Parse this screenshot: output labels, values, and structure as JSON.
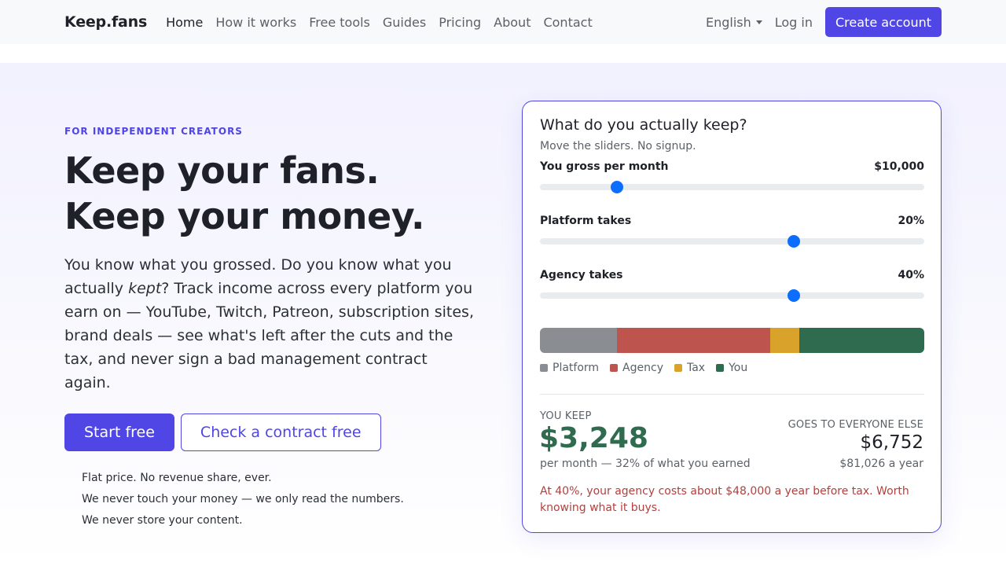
{
  "nav": {
    "brand": "Keep.fans",
    "links": [
      {
        "label": "Home",
        "active": true
      },
      {
        "label": "How it works"
      },
      {
        "label": "Free tools"
      },
      {
        "label": "Guides"
      },
      {
        "label": "Pricing"
      },
      {
        "label": "About"
      },
      {
        "label": "Contact"
      }
    ],
    "language": "English",
    "login": "Log in",
    "create_account": "Create account"
  },
  "hero": {
    "eyebrow": "FOR INDEPENDENT CREATORS",
    "headline_line1": "Keep your fans.",
    "headline_line2": "Keep your money.",
    "lead_part1": "You know what you grossed. Do you know what you actually ",
    "lead_emph": "kept",
    "lead_part2": "? Track income across every platform you earn on — YouTube, Twitch, Patreon, subscription sites, brand deals — see what's left after the cuts and the tax, and never sign a bad management contract again.",
    "cta_primary": "Start free",
    "cta_secondary": "Check a contract free",
    "assurances": [
      "Flat price. No revenue share, ever.",
      "We never touch your money — we only read the numbers.",
      "We never store your content."
    ]
  },
  "calculator": {
    "title": "What do you actually keep?",
    "subtitle": "Move the sliders. No signup.",
    "sliders": [
      {
        "label": "You gross per month",
        "value": "$10,000",
        "fraction": 0.2
      },
      {
        "label": "Platform takes",
        "value": "20%",
        "fraction": 0.66
      },
      {
        "label": "Agency takes",
        "value": "40%",
        "fraction": 0.66
      }
    ],
    "breakdown": [
      {
        "label": "Platform",
        "share": 0.2,
        "color": "#8a8d91"
      },
      {
        "label": "Agency",
        "share": 0.4,
        "color": "#bd554e"
      },
      {
        "label": "Tax",
        "share": 0.0752,
        "color": "#d9a22a"
      },
      {
        "label": "You",
        "share": 0.3248,
        "color": "#2e6b4f"
      }
    ],
    "you_keep_label": "YOU KEEP",
    "you_keep_amount": "$3,248",
    "you_keep_note": "per month — 32% of what you earned",
    "else_label": "GOES TO EVERYONE ELSE",
    "else_amount": "$6,752",
    "else_year": "$81,026 a year",
    "warning": "At 40%, your agency costs about $48,000 a year before tax. Worth knowing what it buys."
  }
}
